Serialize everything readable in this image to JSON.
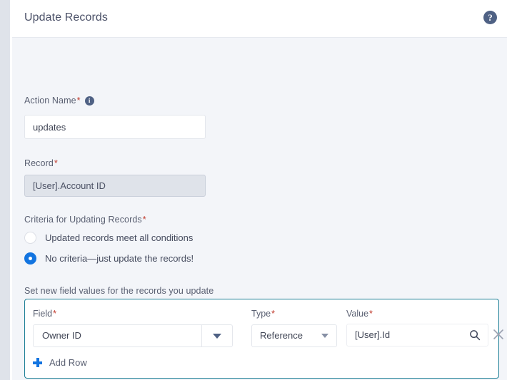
{
  "header": {
    "title": "Update Records",
    "help_icon": "help-circle-icon",
    "help_glyph": "?"
  },
  "form": {
    "action_name": {
      "label": "Action Name",
      "required_marker": "*",
      "info_icon": "info-circle-icon",
      "info_glyph": "i",
      "value": "updates",
      "placeholder": ""
    },
    "record": {
      "label": "Record",
      "required_marker": "*",
      "value": "[User].Account ID",
      "readonly": true
    },
    "criteria": {
      "label": "Criteria for Updating Records",
      "required_marker": "*",
      "options": [
        {
          "label": "Updated records meet all conditions",
          "selected": false
        },
        {
          "label": "No criteria—just update the records!",
          "selected": true
        }
      ]
    },
    "set_values": {
      "section_label": "Set new field values for the records you update",
      "columns": {
        "field": "Field",
        "type": "Type",
        "value": "Value",
        "required_marker": "*"
      },
      "rows": [
        {
          "field": "Owner ID",
          "type": "Reference",
          "value": "[User].Id",
          "search_icon": "search-icon",
          "remove_icon": "close-icon"
        }
      ],
      "add_row_label": "Add Row",
      "add_row_icon": "plus-icon"
    }
  },
  "colors": {
    "accent_blue": "#1274e0",
    "panel_border_teal": "#1d7f96",
    "icon_slate": "#4f6184",
    "required_red": "#c0392b",
    "body_bg": "#f3f5f9",
    "header_bg": "#ffffff"
  }
}
